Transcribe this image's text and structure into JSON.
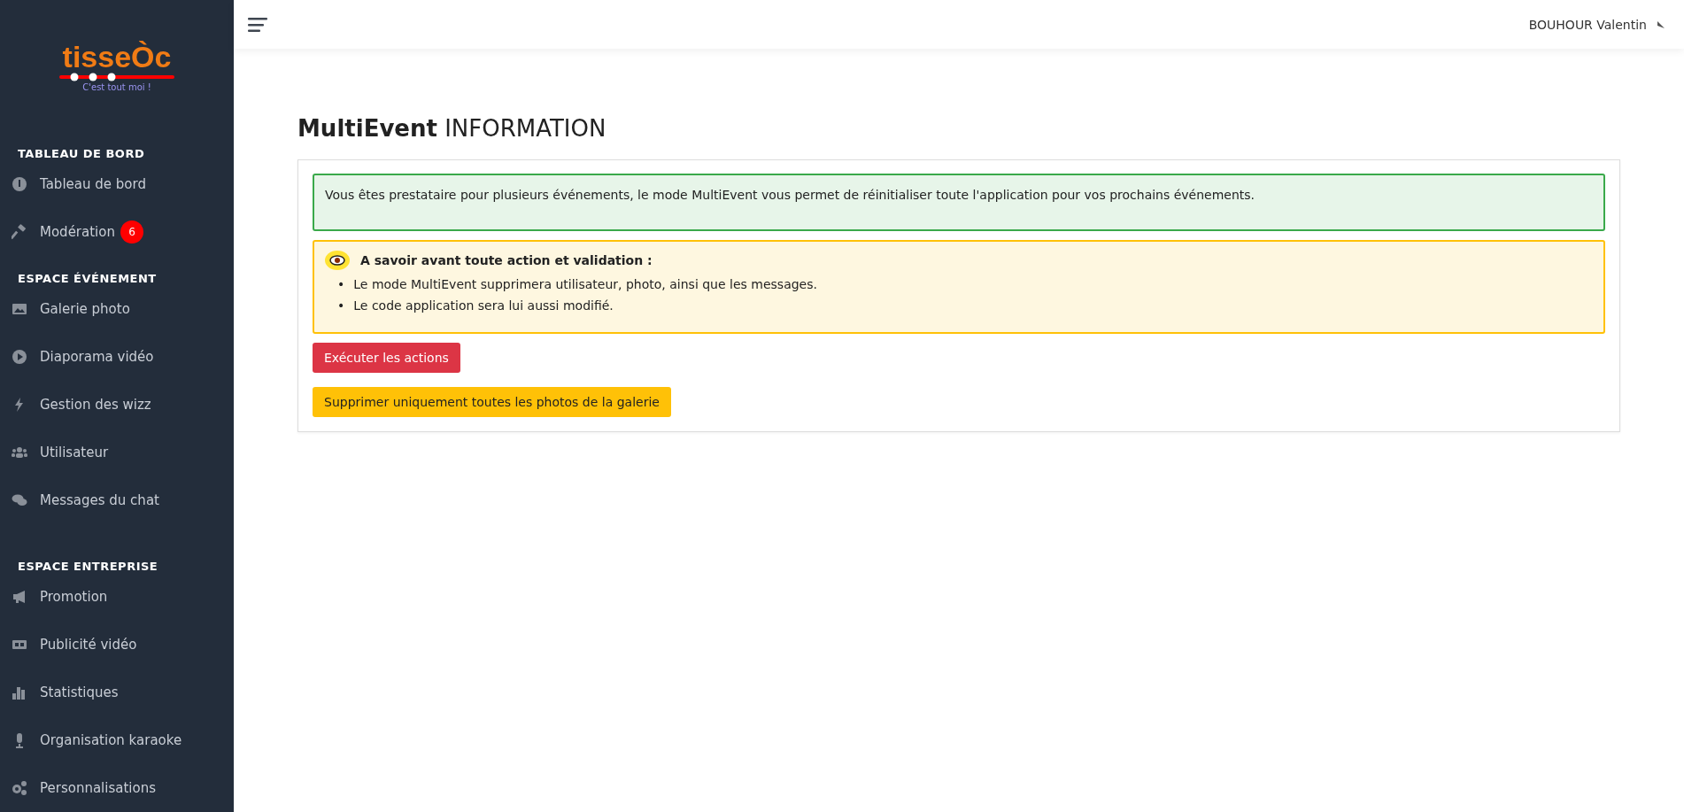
{
  "sidebar": {
    "logo": {
      "wordmark": "tisseÒc",
      "tagline": "C'est tout moi !"
    },
    "sections": [
      {
        "title": "TABLEAU DE BORD",
        "items": [
          {
            "label": "Tableau de bord"
          },
          {
            "label": "Modération",
            "badge": "6"
          }
        ]
      },
      {
        "title": "ESPACE ÉVÉNEMENT",
        "items": [
          {
            "label": "Galerie photo"
          },
          {
            "label": "Diaporama vidéo"
          },
          {
            "label": "Gestion des wizz"
          },
          {
            "label": "Utilisateur"
          },
          {
            "label": "Messages du chat"
          }
        ]
      },
      {
        "title": "ESPACE ENTREPRISE",
        "items": [
          {
            "label": "Promotion"
          },
          {
            "label": "Publicité vidéo"
          },
          {
            "label": "Statistiques"
          },
          {
            "label": "Organisation karaoke"
          },
          {
            "label": "Personnalisations"
          }
        ]
      }
    ]
  },
  "topbar": {
    "user": "BOUHOUR Valentin"
  },
  "page": {
    "title_bold": "MultiEvent",
    "title_rest": "INFORMATION",
    "info": "Vous êtes prestataire pour plusieurs événements, le mode MultiEvent vous permet de réinitialiser toute l'application pour vos prochains événements.",
    "warning": {
      "heading": "A savoir avant toute action et validation :",
      "points": [
        {
          "bullet": "•",
          "text": "Le mode MultiEvent supprimera utilisateur, photo, ainsi que les messages."
        },
        {
          "bullet": "•",
          "text": "Le code application sera lui aussi modifié."
        }
      ]
    },
    "buttons": [
      {
        "label": "Exécuter les actions",
        "kind": "danger"
      },
      {
        "label": "Supprimer uniquement toutes les photos de la galerie",
        "kind": "warning"
      }
    ]
  }
}
